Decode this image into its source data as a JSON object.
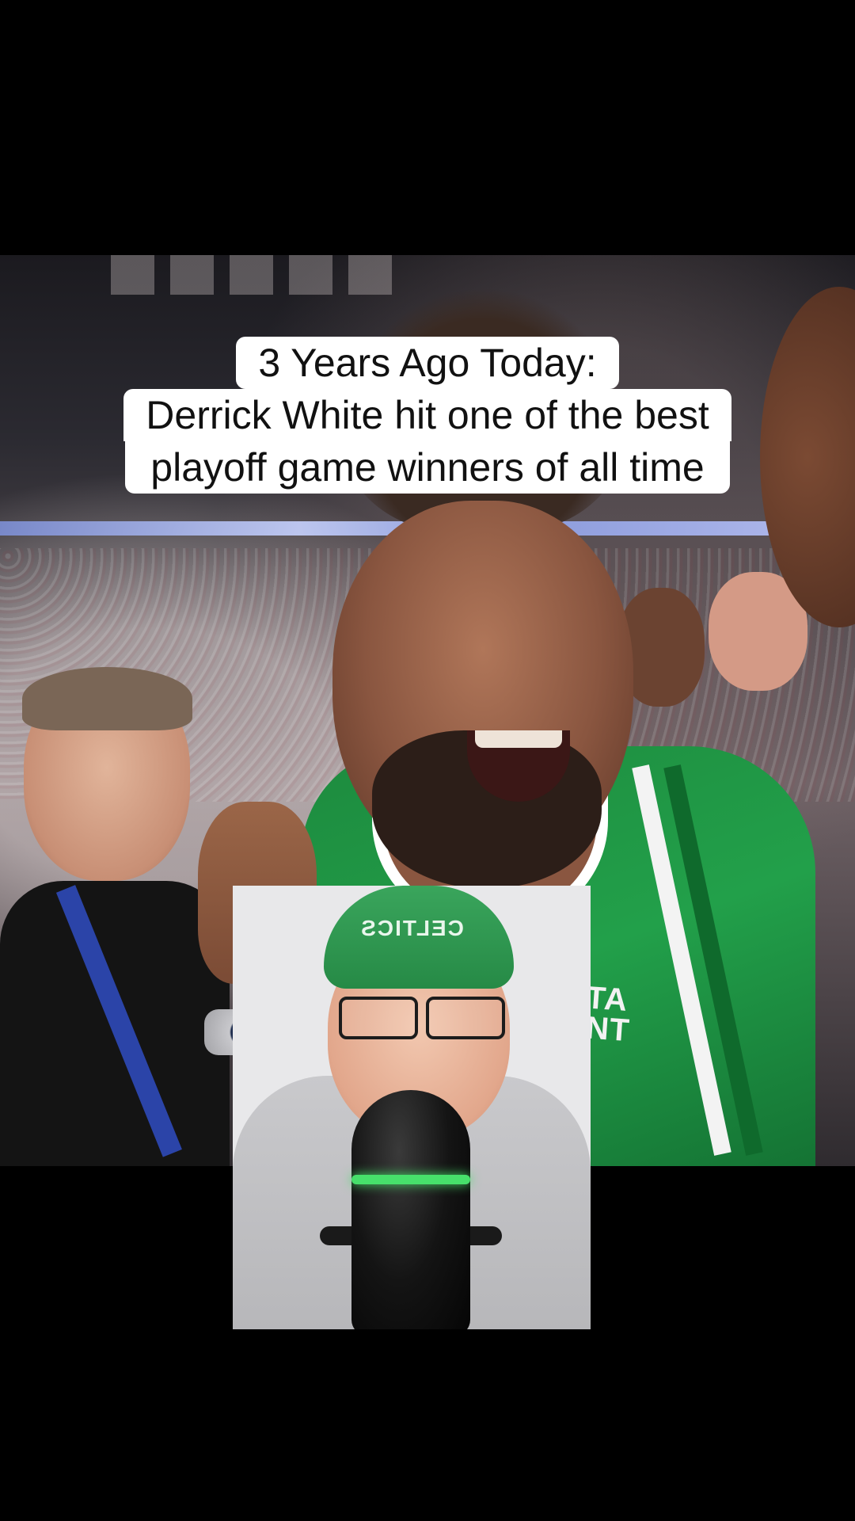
{
  "caption": {
    "line1": "3 Years Ago Today:",
    "line2": "Derrick White hit one of the best",
    "line3": "playoff game winners of all time"
  },
  "photo": {
    "jersey_text_line1": "VISTA",
    "jersey_text_line2": "PRINT"
  },
  "cam": {
    "beanie_text": "CELTICS"
  },
  "colors": {
    "celtics_green": "#22a04a",
    "mic_ring": "#47e06b",
    "caption_bg": "#ffffff"
  }
}
